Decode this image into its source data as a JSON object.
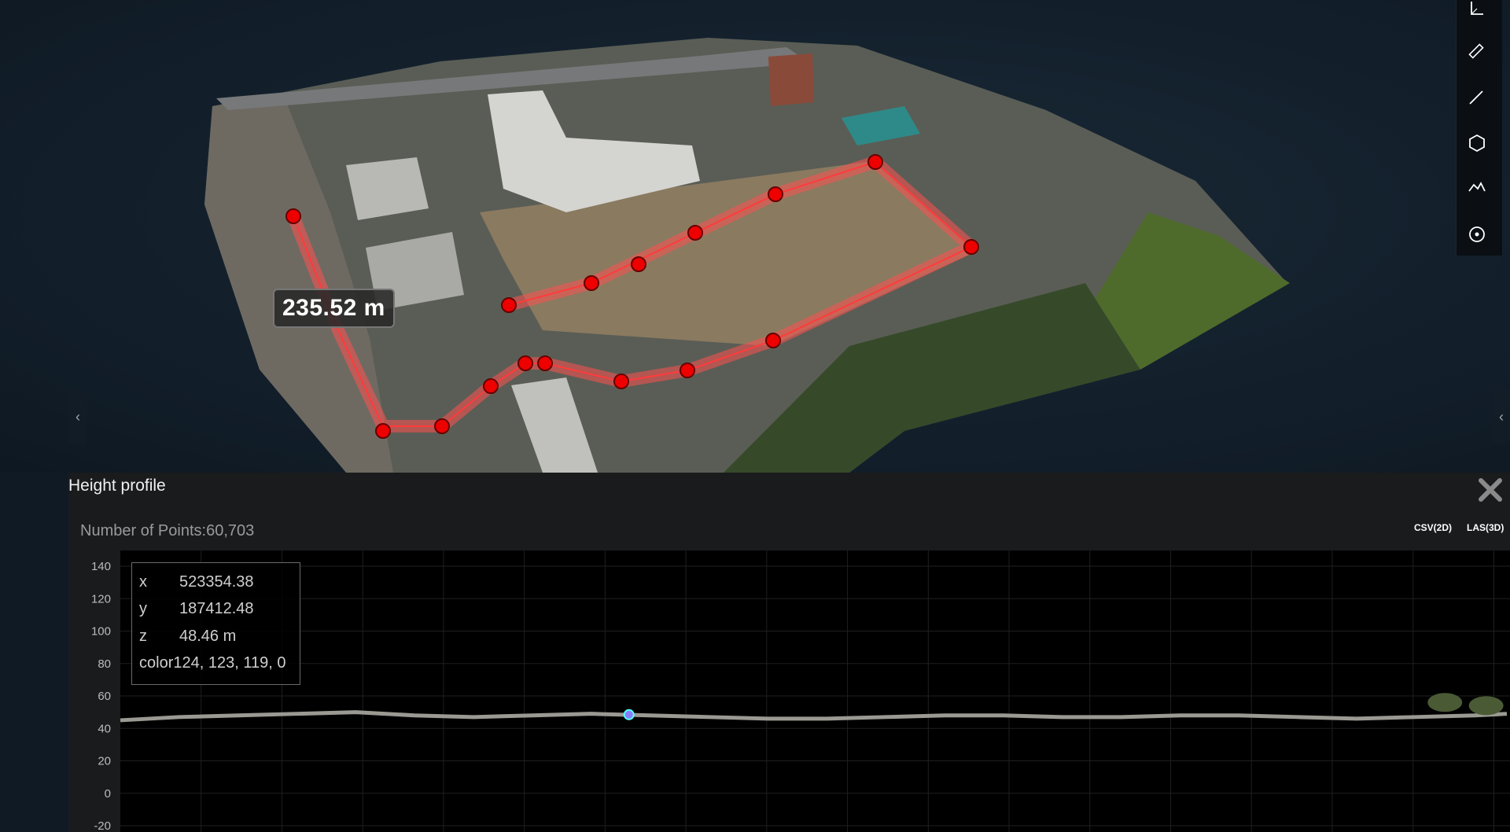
{
  "viewer": {
    "measurement_label": "235.52 m",
    "tools": [
      {
        "icon": "axis-icon"
      },
      {
        "icon": "ruler-icon"
      },
      {
        "icon": "line-distance-icon"
      },
      {
        "icon": "polygon-area-icon"
      },
      {
        "icon": "height-profile-icon"
      },
      {
        "icon": "point-target-icon"
      }
    ],
    "left_arrow": "‹",
    "right_arrow": "‹"
  },
  "panel": {
    "title": "Height profile",
    "points_label": "Number of Points:",
    "points_value": "60,703",
    "export_csv": "CSV(2D)",
    "export_las": "LAS(3D)"
  },
  "tooltip": {
    "x_label": "x",
    "x_value": "523354.38",
    "y_label": "y",
    "y_value": "187412.48",
    "z_label": "z",
    "z_value": "48.46 m",
    "color_label": "color",
    "color_value": "124, 123, 119, 0"
  },
  "chart_data": {
    "type": "scatter",
    "title": "",
    "xlabel": "",
    "ylabel": "",
    "ylim": [
      -20,
      140
    ],
    "y_ticks": [
      "140",
      "120",
      "100",
      "80",
      "60",
      "40",
      "20",
      "0",
      "-20"
    ],
    "grid": true,
    "profile": {
      "x": [
        0,
        10,
        20,
        30,
        40,
        50,
        60,
        70,
        80,
        90,
        100,
        110,
        120,
        130,
        140,
        150,
        160,
        170,
        180,
        190,
        200,
        210,
        220,
        230,
        235.52
      ],
      "z": [
        45,
        47,
        48,
        49,
        50,
        48,
        47,
        48,
        49,
        48,
        47,
        46,
        46,
        47,
        48,
        48,
        47,
        47,
        48,
        48,
        47,
        46,
        47,
        48,
        49
      ]
    },
    "features": [
      {
        "x": 225,
        "z": 56
      },
      {
        "x": 232,
        "z": 54
      }
    ],
    "highlight_point": {
      "x": 86.4,
      "z": 48.46
    }
  }
}
